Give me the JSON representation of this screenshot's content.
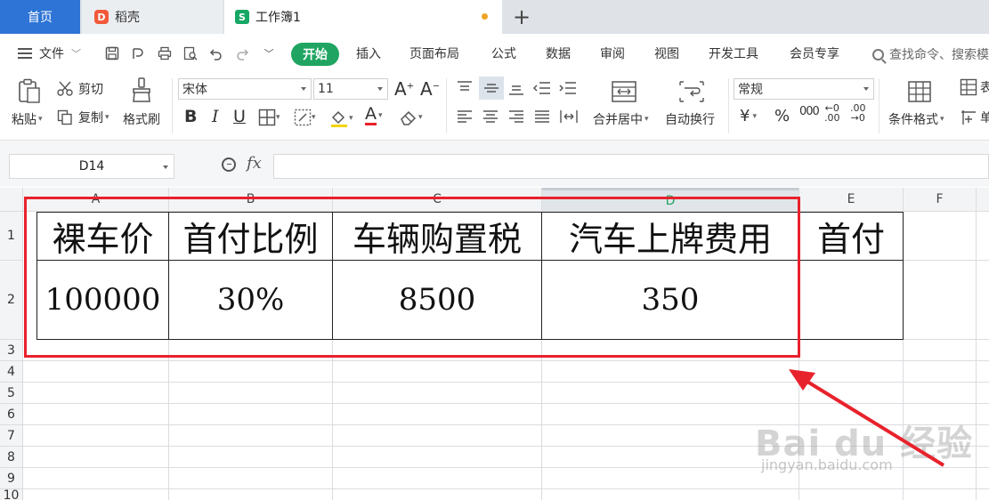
{
  "tabs": {
    "home": "首页",
    "docer": "稻壳",
    "workbook": "工作簿1",
    "add": "+"
  },
  "menu": {
    "file": "文件",
    "start": "开始",
    "insert": "插入",
    "page_layout": "页面布局",
    "formula": "公式",
    "data": "数据",
    "review": "审阅",
    "view": "视图",
    "dev_tools": "开发工具",
    "member": "会员专享",
    "search_placeholder": "查找命令、搜索模"
  },
  "ribbon": {
    "paste": "粘贴",
    "cut": "剪切",
    "copy": "复制",
    "format_painter": "格式刷",
    "font_name": "宋体",
    "font_size": "11",
    "merge_center": "合并居中",
    "wrap_text": "自动换行",
    "number_format": "常规",
    "conditional_format": "条件格式",
    "table_style_partial": "表",
    "cell_partial": "单",
    "currency_symbol": "¥",
    "percent_symbol": "%",
    "thousands_symbol": "000",
    "inc_decimal": "←0\n.00",
    "dec_decimal": ".00\n→0"
  },
  "formula_bar": {
    "name_box": "D14",
    "fx": "fx",
    "content": ""
  },
  "grid": {
    "columns": [
      "A",
      "B",
      "C",
      "D",
      "E",
      "F"
    ],
    "rows": [
      "1",
      "2",
      "3",
      "4",
      "5",
      "6",
      "7",
      "8",
      "9",
      "10"
    ],
    "active_column": "D",
    "row1": [
      "裸车价",
      "首付比例",
      "车辆购置税",
      "汽车上牌费用",
      "首付"
    ],
    "row2": [
      "100000",
      "30%",
      "8500",
      "350",
      ""
    ]
  },
  "annotation": {
    "box_color": "#e8222c",
    "arrow_color": "#e8222c"
  },
  "watermark": {
    "brand": "Bai du 经验",
    "url": "jingyan.baidu.com"
  }
}
